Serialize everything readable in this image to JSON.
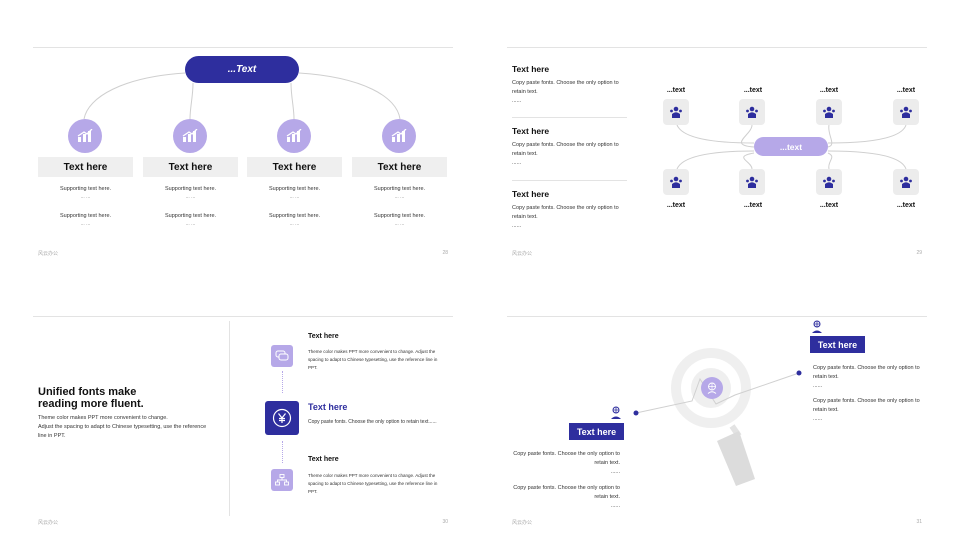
{
  "footer_brand": "风云办公",
  "slide1": {
    "top_pill": "...Text",
    "page_number": "28",
    "columns": [
      {
        "title": "Text here",
        "support1": "Supporting text here.",
        "dots1": "... ...",
        "support2": "Supporting text here.",
        "dots2": "... ..."
      },
      {
        "title": "Text here",
        "support1": "Supporting text here.",
        "dots1": "... ...",
        "support2": "Supporting text here.",
        "dots2": "... ..."
      },
      {
        "title": "Text here",
        "support1": "Supporting text here.",
        "dots1": "... ...",
        "support2": "Supporting text here.",
        "dots2": "... ..."
      },
      {
        "title": "Text here",
        "support1": "Supporting text here.",
        "dots1": "... ...",
        "support2": "Supporting text here.",
        "dots2": "... ..."
      }
    ]
  },
  "slide2": {
    "page_number": "29",
    "items": [
      {
        "title": "Text here",
        "body": "Copy paste fonts. Choose the only option to retain text.",
        "dots": "......"
      },
      {
        "title": "Text here",
        "body": "Copy paste fonts. Choose the only option to retain text.",
        "dots": "......"
      },
      {
        "title": "Text here",
        "body": "Copy paste fonts. Choose the only option to retain text.",
        "dots": "......"
      }
    ],
    "center_pill": "...text",
    "top_labels": [
      "...text",
      "...text",
      "...text",
      "...text"
    ],
    "bottom_labels": [
      "...text",
      "...text",
      "...text",
      "...text"
    ]
  },
  "slide3": {
    "page_number": "30",
    "heading_line1": "Unified fonts make",
    "heading_line2": "reading more fluent.",
    "body_line1": "Theme color makes PPT more convenient to change.",
    "body_line2": "Adjust the spacing to adapt to Chinese typesetting, use the reference line in PPT.",
    "items": [
      {
        "title": "Text here",
        "body": "Theme color makes PPT more convenient to change. Adjust the spacing to adapt to Chinese typesetting, use the reference line in PPT."
      },
      {
        "title": "Text here",
        "body": "Copy paste fonts. Choose the only option to retain text......"
      },
      {
        "title": "Text here",
        "body": "Theme color makes PPT more convenient to change. Adjust the spacing to adapt to Chinese typesetting, use the reference line in PPT."
      }
    ]
  },
  "slide4": {
    "page_number": "31",
    "right_box": "Text here",
    "left_box": "Text here",
    "right_items": [
      {
        "body": "Copy paste fonts. Choose the only option to retain text.",
        "dots": "......"
      },
      {
        "body": "Copy paste fonts. Choose the only option to retain text.",
        "dots": "......"
      }
    ],
    "left_items": [
      {
        "body": "Copy paste fonts. Choose the only option to retain text.",
        "dots": "......"
      },
      {
        "body": "Copy paste fonts. Choose the only option to retain text.",
        "dots": "......"
      }
    ]
  },
  "colors": {
    "navy": "#2e2e9e",
    "lavender": "#b6a8e8",
    "gray_box": "#efefef"
  }
}
